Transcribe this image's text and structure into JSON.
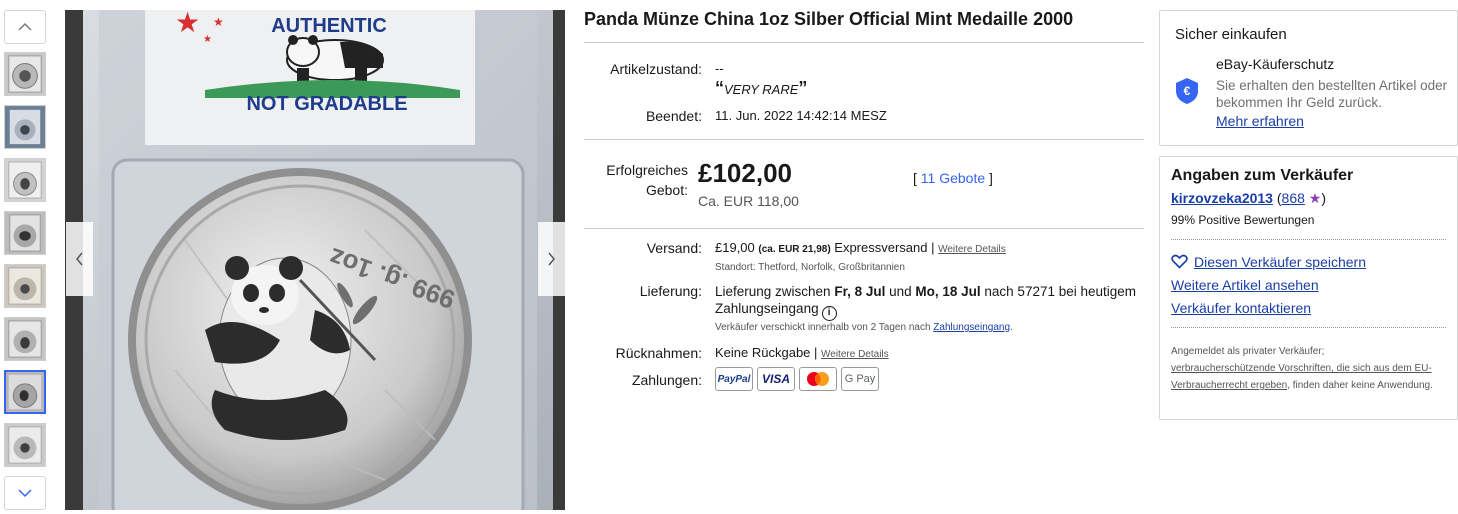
{
  "title": "Panda Münze China 1oz Silber Official Mint Medaille 2000",
  "image": {
    "label_top": "AUTHENTIC",
    "label_bottom": "NOT GRADABLE",
    "coin_text": "999 .g. 1oz"
  },
  "condition": {
    "label": "Artikelzustand:",
    "value": "--",
    "quote_open": "“",
    "quote_text": "VERY RARE",
    "quote_close": "”"
  },
  "ended": {
    "label": "Beendet:",
    "value": "11. Jun. 2022  14:42:14 MESZ"
  },
  "winning_bid": {
    "label_line1": "Erfolgreiches",
    "label_line2": "Gebot:",
    "price": "£102,00",
    "price_eur": "Ca. EUR 118,00",
    "bids_open": "[ ",
    "bids_link": "11 Gebote",
    "bids_close": " ]"
  },
  "shipping": {
    "label": "Versand:",
    "price": "£19,00",
    "eur": "(ca. EUR 21,98)",
    "method": "Expressversand |",
    "details_link": "Weitere Details",
    "location": "Standort: Thetford, Norfolk, Großbritannien"
  },
  "delivery": {
    "label": "Lieferung:",
    "text_1": "Lieferung zwischen ",
    "date_1": "Fr, 8 Jul",
    "text_2": " und ",
    "date_2": "Mo, 18 Jul",
    "text_3": " nach 57271 bei heutigem",
    "text_4": "Zahlungseingang",
    "info_icon": "i",
    "note": "Verkäufer verschickt innerhalb von 2 Tagen nach ",
    "note_link": "Zahlungseingang",
    "note_end": "."
  },
  "returns": {
    "label": "Rücknahmen:",
    "value": "Keine Rückgabe |",
    "details_link": "Weitere Details"
  },
  "payments": {
    "label": "Zahlungen:",
    "methods": [
      "PayPal",
      "VISA",
      "G Pay"
    ]
  },
  "secure": {
    "title": "Sicher einkaufen",
    "protection": "eBay-Käuferschutz",
    "text": "Sie erhalten den bestellten Artikel oder bekommen Ihr Geld zurück.",
    "link": "Mehr erfahren"
  },
  "seller": {
    "title": "Angaben zum Verkäufer",
    "name": "kirzovzeka2013",
    "paren_open": " (",
    "score": "868",
    "star": "★",
    "paren_close": ")",
    "positive": "99% Positive Bewertungen",
    "save": "Diesen Verkäufer speichern",
    "more_items": "Weitere Artikel ansehen",
    "contact": "Verkäufer kontaktieren",
    "legal_1": "Angemeldet als privater Verkäufer;",
    "legal_link": "verbraucherschützende Vorschriften, die sich aus dem EU-Verbraucherrecht ergeben",
    "legal_2": ", finden daher keine Anwendung."
  },
  "colors": {
    "link": "#3665f3",
    "seller_link": "#1a3ea8",
    "star": "#8a3fb3",
    "shield": "#3665f3"
  },
  "icons": [
    "chevron-up-icon",
    "chevron-down-icon",
    "chevron-left-icon",
    "chevron-right-icon",
    "info-icon",
    "shield-euro-icon",
    "heart-icon",
    "star-icon"
  ]
}
